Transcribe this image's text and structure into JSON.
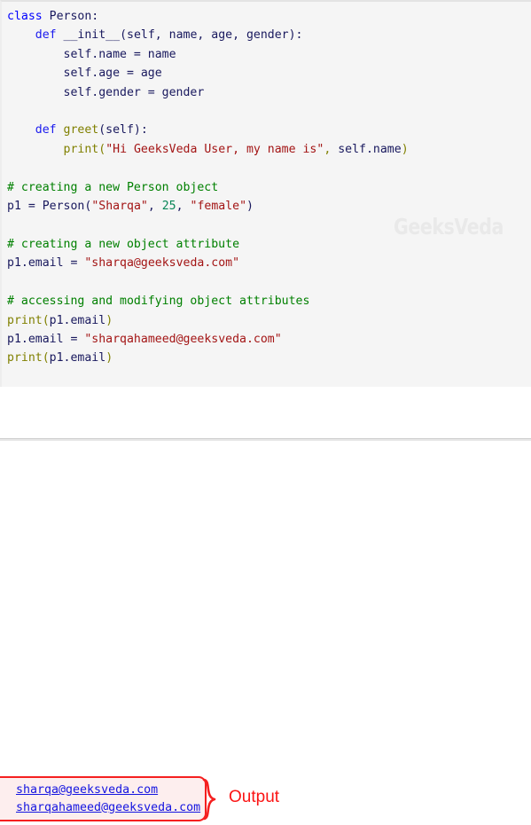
{
  "language": "python",
  "theme": {
    "code_background": "#f5f5f5",
    "page_background": "#ffffff",
    "keyword_color": "#0000ff",
    "identifier_color": "#19195e",
    "function_color": "#808000",
    "string_color": "#a31515",
    "number_color": "#098658",
    "comment_color": "#008000",
    "callout_border": "#f51f1f",
    "callout_fill": "#fdeeee",
    "callout_label_color": "#fb1414",
    "link_color": "#1414e0",
    "watermark_color": "#e9e9e9"
  },
  "watermark": {
    "text": "GeeksVeda"
  },
  "code": {
    "lines": [
      [
        {
          "t": "class ",
          "c": "t-kw"
        },
        {
          "t": "Person:",
          "c": "t-id"
        }
      ],
      [
        {
          "t": "    ",
          "c": "t-pl"
        },
        {
          "t": "def ",
          "c": "t-def"
        },
        {
          "t": "__init__",
          "c": "t-id"
        },
        {
          "t": "(self, name, age, gender):",
          "c": "t-name"
        }
      ],
      [
        {
          "t": "        self.name = name",
          "c": "t-name"
        }
      ],
      [
        {
          "t": "        self.age = age",
          "c": "t-name"
        }
      ],
      [
        {
          "t": "        self.gender = gender",
          "c": "t-name"
        }
      ],
      [
        {
          "t": "",
          "c": "t-pl"
        }
      ],
      [
        {
          "t": "    ",
          "c": "t-pl"
        },
        {
          "t": "def ",
          "c": "t-def"
        },
        {
          "t": "greet",
          "c": "t-fn"
        },
        {
          "t": "(self):",
          "c": "t-name"
        }
      ],
      [
        {
          "t": "        ",
          "c": "t-pl"
        },
        {
          "t": "print",
          "c": "t-fn"
        },
        {
          "t": "(",
          "c": "t-fn"
        },
        {
          "t": "\"Hi GeeksVeda User, my name is\"",
          "c": "t-str"
        },
        {
          "t": ", ",
          "c": "t-fn"
        },
        {
          "t": "self.name",
          "c": "t-name"
        },
        {
          "t": ")",
          "c": "t-fn"
        }
      ],
      [
        {
          "t": "",
          "c": "t-pl"
        }
      ],
      [
        {
          "t": "# creating a new Person object",
          "c": "t-cmt"
        }
      ],
      [
        {
          "t": "p1 ",
          "c": "t-id"
        },
        {
          "t": "= ",
          "c": "t-op"
        },
        {
          "t": "Person",
          "c": "t-id"
        },
        {
          "t": "(",
          "c": "t-op"
        },
        {
          "t": "\"Sharqa\"",
          "c": "t-str"
        },
        {
          "t": ", ",
          "c": "t-op"
        },
        {
          "t": "25",
          "c": "t-num"
        },
        {
          "t": ", ",
          "c": "t-op"
        },
        {
          "t": "\"female\"",
          "c": "t-str"
        },
        {
          "t": ")",
          "c": "t-op"
        }
      ],
      [
        {
          "t": "",
          "c": "t-pl"
        }
      ],
      [
        {
          "t": "# creating a new object attribute",
          "c": "t-cmt"
        }
      ],
      [
        {
          "t": "p1.email ",
          "c": "t-id"
        },
        {
          "t": "= ",
          "c": "t-op"
        },
        {
          "t": "\"sharqa@geeksveda.com\"",
          "c": "t-str"
        }
      ],
      [
        {
          "t": "",
          "c": "t-pl"
        }
      ],
      [
        {
          "t": "# accessing and modifying object attributes",
          "c": "t-cmt"
        }
      ],
      [
        {
          "t": "print",
          "c": "t-fn"
        },
        {
          "t": "(",
          "c": "t-fn"
        },
        {
          "t": "p1.email",
          "c": "t-name"
        },
        {
          "t": ")",
          "c": "t-fn"
        }
      ],
      [
        {
          "t": "p1.email ",
          "c": "t-id"
        },
        {
          "t": "= ",
          "c": "t-op"
        },
        {
          "t": "\"sharqahameed@geeksveda.com\"",
          "c": "t-str"
        }
      ],
      [
        {
          "t": "print",
          "c": "t-fn"
        },
        {
          "t": "(",
          "c": "t-fn"
        },
        {
          "t": "p1.email",
          "c": "t-name"
        },
        {
          "t": ")",
          "c": "t-fn"
        }
      ]
    ],
    "plain_text": "class Person:\n    def __init__(self, name, age, gender):\n        self.name = name\n        self.age = age\n        self.gender = gender\n\n    def greet(self):\n        print(\"Hi GeeksVeda User, my name is\", self.name)\n\n# creating a new Person object\np1 = Person(\"Sharqa\", 25, \"female\")\n\n# creating a new object attribute\np1.email = \"sharqa@geeksveda.com\"\n\n# accessing and modifying object attributes\nprint(p1.email)\np1.email = \"sharqahameed@geeksveda.com\"\nprint(p1.email)"
  },
  "output": {
    "label": "Output",
    "lines": [
      "sharqa@geeksveda.com",
      "sharqahameed@geeksveda.com"
    ]
  }
}
